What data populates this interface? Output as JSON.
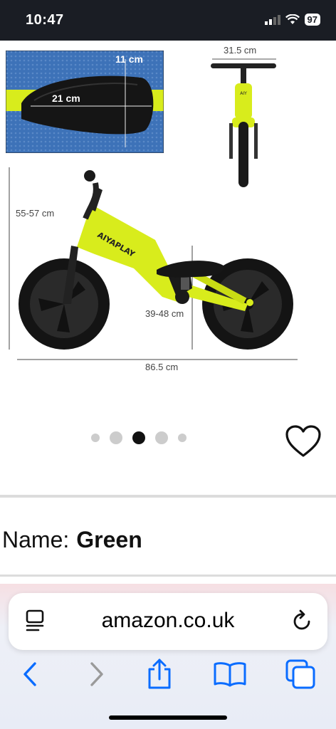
{
  "status_bar": {
    "time": "10:47",
    "battery": "97"
  },
  "product": {
    "dimensions": {
      "seat_width": "11 cm",
      "seat_length": "21 cm",
      "handlebar_width": "31.5 cm",
      "handlebar_height": "55-57 cm",
      "seat_height": "39-48 cm",
      "overall_length": "86.5 cm"
    },
    "brand_on_frame": "AIYAPLAY",
    "carousel": {
      "total": 5,
      "active_index": 2
    },
    "name_label": "Name:",
    "name_value": "Green"
  },
  "browser": {
    "url": "amazon.co.uk"
  },
  "colors": {
    "bike": "#d8ec1c",
    "accent": "#0a6cff"
  }
}
